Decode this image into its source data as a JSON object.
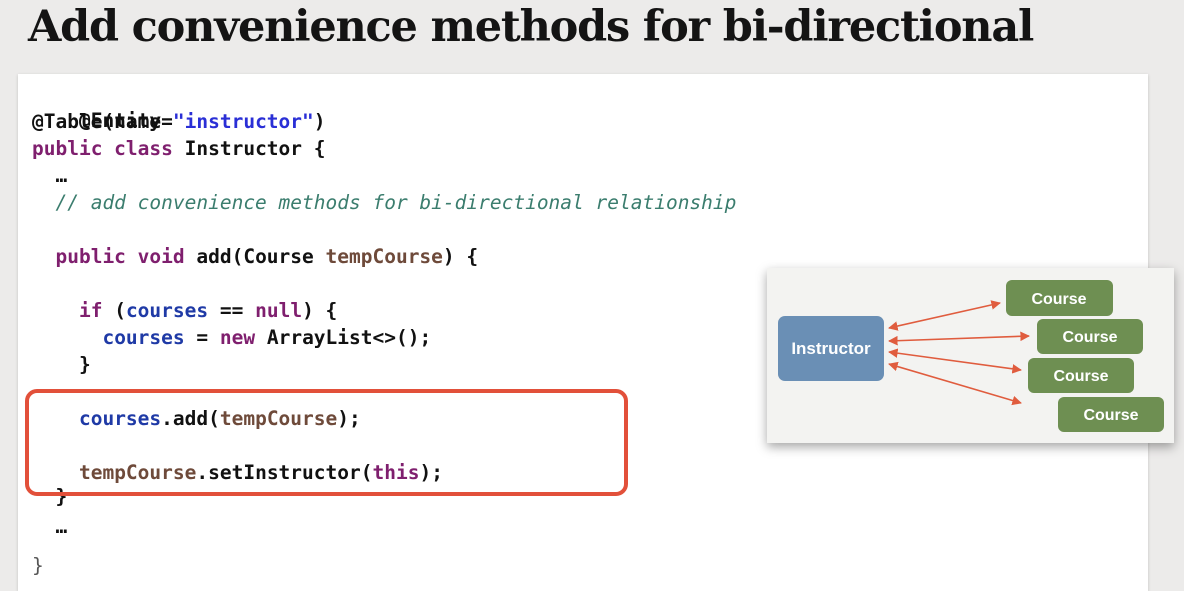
{
  "slide": {
    "title": "Add convenience methods for bi-directional"
  },
  "code": {
    "l1": "@Entity",
    "l2_prefix": "@Table(name=",
    "l2_string": "\"instructor\"",
    "l2_suffix": ")",
    "l3_kw": "public class",
    "l3_rest": " Instructor {",
    "l4": "  …",
    "l5_comment": "  // add convenience methods for bi-directional relationship",
    "l7_indent": "  ",
    "l7_kw": "public void",
    "l7_mid": " add(Course ",
    "l7_param": "tempCourse",
    "l7_end": ") {",
    "l9_indent": "    ",
    "l9_kw": "if",
    "l9_open": " (",
    "l9_field": "courses",
    "l9_op": " == ",
    "l9_null": "null",
    "l9_end": ") {",
    "l10_indent": "      ",
    "l10_field": "courses",
    "l10_op": " = ",
    "l10_new": "new",
    "l10_rest": " ArrayList<>();",
    "l11": "    }",
    "l13_indent": "    ",
    "l13_field": "courses",
    "l13_mid": ".add(",
    "l13_param": "tempCourse",
    "l13_end": ");",
    "l15_indent": "    ",
    "l15_param": "tempCourse",
    "l15_mid": ".setInstructor(",
    "l15_this": "this",
    "l15_end": ");",
    "l16": "  }",
    "l17": "  …",
    "l18": "}"
  },
  "diagram": {
    "instructor_label": "Instructor",
    "course_labels": [
      "Course",
      "Course",
      "Course",
      "Course"
    ],
    "colors": {
      "instructor": "#6a8fb5",
      "course": "#6e8f52",
      "arrow": "#e05c3e"
    }
  },
  "colors": {
    "highlight": "#e2503a",
    "keyword": "#7f1f6e",
    "string": "#2a2fd6",
    "field": "#1f3aa6",
    "parameter": "#6e4a3a",
    "comment": "#3b7d6e"
  }
}
